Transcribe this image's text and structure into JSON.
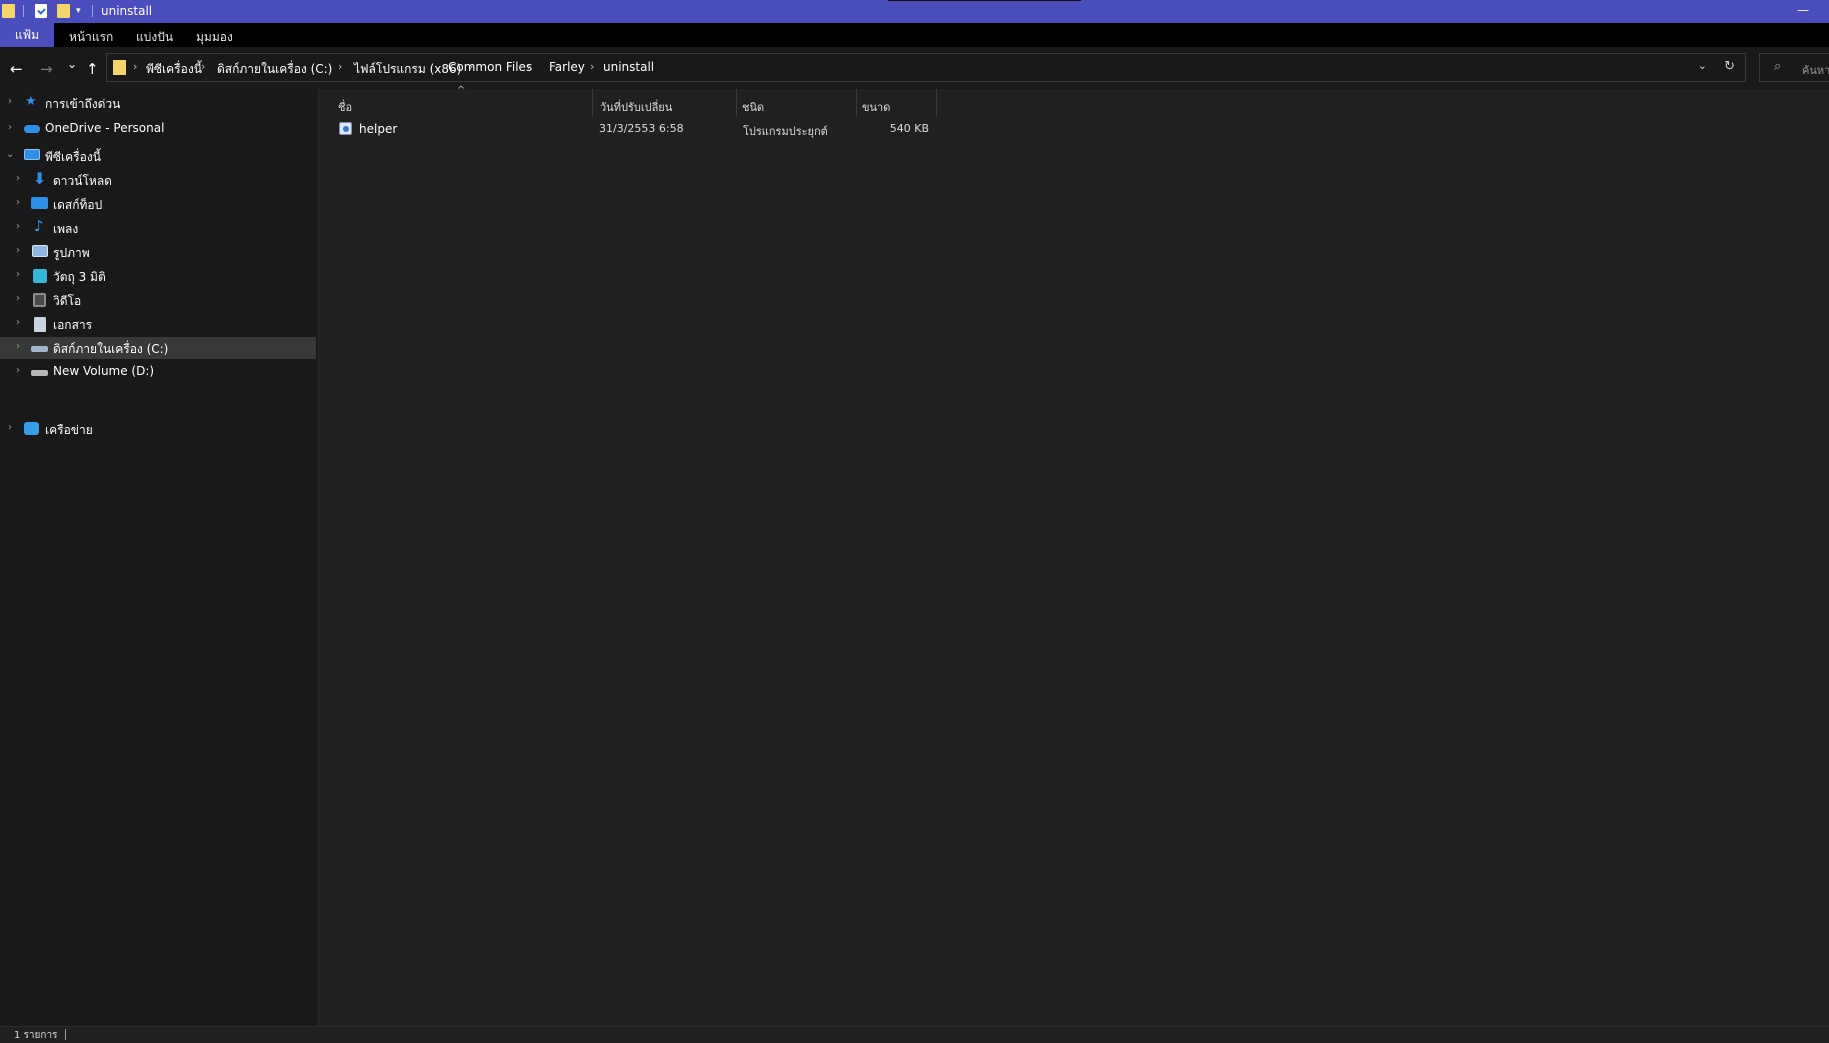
{
  "window": {
    "title": "uninstall",
    "minimize_label": "—",
    "qa_dropdown_label": "▾"
  },
  "ribbon": {
    "tabs": [
      {
        "label": "แฟ้ม",
        "active": true
      },
      {
        "label": "หน้าแรก"
      },
      {
        "label": "แบ่งปัน"
      },
      {
        "label": "มุมมอง"
      }
    ]
  },
  "nav": {
    "back_label": "←",
    "forward_label": "→",
    "recent_label": "⌄",
    "up_label": "↑"
  },
  "address": {
    "crumbs": [
      "พีซีเครื่องนี้",
      "ดิสก์ภายในเครื่อง (C:)",
      "ไฟล์โปรแกรม (x86)",
      "Common Files",
      "Farley",
      "uninstall"
    ],
    "separator": "›",
    "dropdown_label": "⌄",
    "refresh_label": "↻"
  },
  "search": {
    "placeholder": "ค้นหา",
    "icon": "search-icon"
  },
  "sidebar": {
    "quick_access": "การเข้าถึงด่วน",
    "onedrive": "OneDrive - Personal",
    "this_pc": "พีซีเครื่องนี้",
    "items": [
      {
        "label": "ดาวน์โหลด",
        "icon": "download-icon",
        "color": "#2f8fe6"
      },
      {
        "label": "เดสก์ท็อป",
        "icon": "desktop-icon",
        "color": "#2f8fe6"
      },
      {
        "label": "เพลง",
        "icon": "music-icon",
        "color": "#3a9be8"
      },
      {
        "label": "รูปภาพ",
        "icon": "pictures-icon",
        "color": "#8fb6dc"
      },
      {
        "label": "วัตถุ 3 มิติ",
        "icon": "3d-objects-icon",
        "color": "#35b5d8"
      },
      {
        "label": "วิดีโอ",
        "icon": "videos-icon",
        "color": "#8d8d8d"
      },
      {
        "label": "เอกสาร",
        "icon": "documents-icon",
        "color": "#c9d4e0"
      },
      {
        "label": "ดิสก์ภายในเครื่อง (C:)",
        "icon": "drive-c-icon",
        "color": "#9fb6cc",
        "selected": true
      },
      {
        "label": "New Volume (D:)",
        "icon": "drive-d-icon",
        "color": "#b7b7b7"
      }
    ],
    "network": "เครือข่าย",
    "expand_glyph": "›",
    "collapse_glyph": "⌄"
  },
  "columns": {
    "name": "ชื่อ",
    "modified": "วันที่ปรับเปลี่ยน",
    "type": "ชนิด",
    "size": "ขนาด",
    "sort_glyph": "^"
  },
  "files": [
    {
      "name": "helper",
      "modified": "31/3/2553 6:58",
      "type": "โปรแกรมประยุกต์",
      "size": "540 KB"
    }
  ],
  "status": {
    "items_count": "1 รายการ"
  },
  "colors": {
    "titlebar": "#4b4dbd",
    "background": "#202020",
    "sidebar": "#191919",
    "selected": "#383838"
  }
}
